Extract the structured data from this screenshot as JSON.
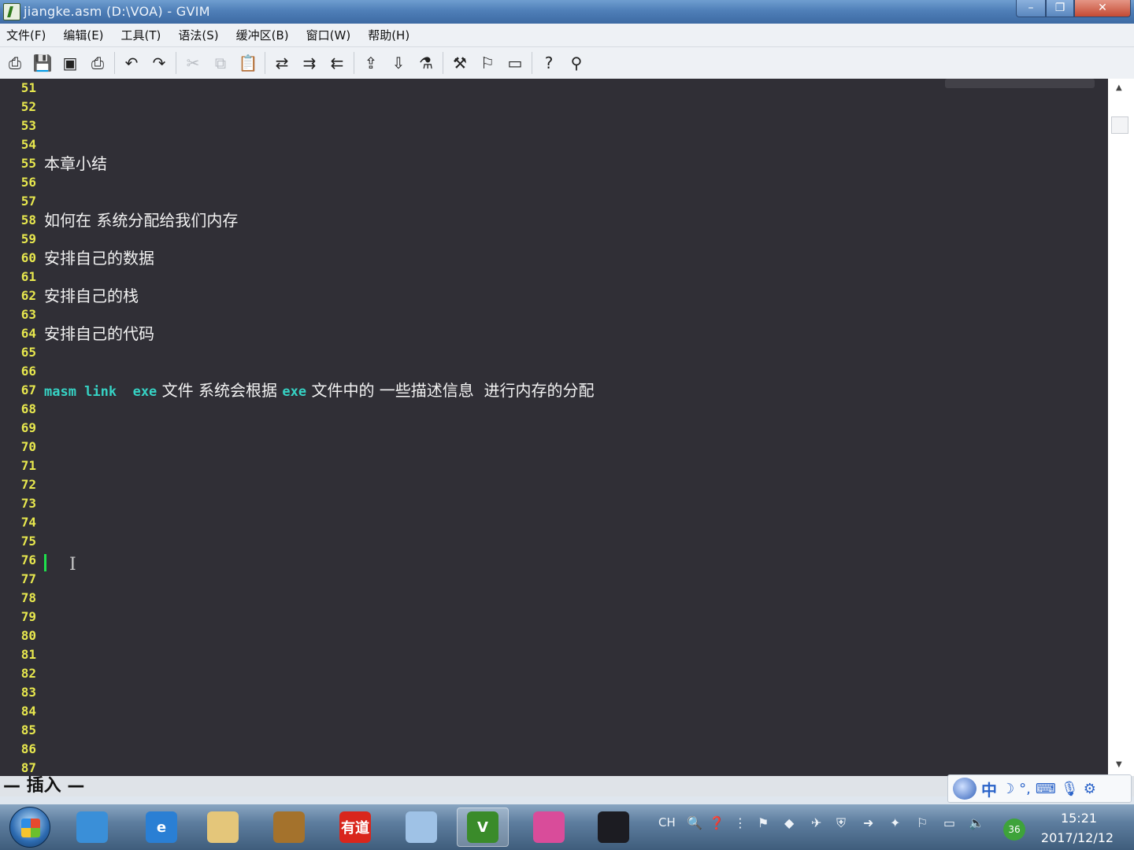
{
  "window": {
    "title": "jiangke.asm (D:\\VOA) - GVIM",
    "controls": {
      "minimize": "–",
      "maximize": "❐",
      "close": "✕"
    }
  },
  "menubar": {
    "items": [
      "文件(F)",
      "编辑(E)",
      "工具(T)",
      "语法(S)",
      "缓冲区(B)",
      "窗口(W)",
      "帮助(H)"
    ]
  },
  "toolbar": {
    "icons": [
      {
        "name": "open-icon",
        "glyph": "⎙"
      },
      {
        "name": "save-icon",
        "glyph": "💾"
      },
      {
        "name": "save-all-icon",
        "glyph": "▣"
      },
      {
        "name": "print-icon",
        "glyph": "⎙"
      },
      {
        "sep": true
      },
      {
        "name": "undo-icon",
        "glyph": "↶"
      },
      {
        "name": "redo-icon",
        "glyph": "↷"
      },
      {
        "sep": true
      },
      {
        "name": "cut-icon",
        "glyph": "✂",
        "dim": true
      },
      {
        "name": "copy-icon",
        "glyph": "⧉",
        "dim": true
      },
      {
        "name": "paste-icon",
        "glyph": "📋"
      },
      {
        "sep": true
      },
      {
        "name": "replace-icon",
        "glyph": "⇄"
      },
      {
        "name": "find-next-icon",
        "glyph": "⇉"
      },
      {
        "name": "find-prev-icon",
        "glyph": "⇇"
      },
      {
        "sep": true
      },
      {
        "name": "load-session-icon",
        "glyph": "⇪"
      },
      {
        "name": "save-session-icon",
        "glyph": "⇩"
      },
      {
        "name": "run-script-icon",
        "glyph": "⚗"
      },
      {
        "sep": true
      },
      {
        "name": "make-icon",
        "glyph": "⚒"
      },
      {
        "name": "shell-icon",
        "glyph": "⚐"
      },
      {
        "name": "tags-icon",
        "glyph": "▭"
      },
      {
        "sep": true
      },
      {
        "name": "help-icon",
        "glyph": "?"
      },
      {
        "name": "find-help-icon",
        "glyph": "⚲"
      }
    ]
  },
  "editor": {
    "lines": [
      {
        "n": "51",
        "text": ""
      },
      {
        "n": "52",
        "text": ""
      },
      {
        "n": "53",
        "text": ""
      },
      {
        "n": "54",
        "text": ""
      },
      {
        "n": "55",
        "text": "本章小结"
      },
      {
        "n": "56",
        "text": ""
      },
      {
        "n": "57",
        "text": ""
      },
      {
        "n": "58",
        "text": "如何在 系统分配给我们内存"
      },
      {
        "n": "59",
        "text": ""
      },
      {
        "n": "60",
        "text": "安排自己的数据"
      },
      {
        "n": "61",
        "text": ""
      },
      {
        "n": "62",
        "text": "安排自己的栈"
      },
      {
        "n": "63",
        "text": ""
      },
      {
        "n": "64",
        "text": "安排自己的代码"
      },
      {
        "n": "65",
        "text": ""
      },
      {
        "n": "66",
        "text": ""
      },
      {
        "n": "67",
        "segments": [
          {
            "kw": true,
            "t": "masm link  exe"
          },
          {
            "kw": false,
            "t": " 文件 系统会根据 "
          },
          {
            "kw": true,
            "t": "exe"
          },
          {
            "kw": false,
            "t": " 文件中的 一些描述信息  进行内存的分配"
          }
        ]
      },
      {
        "n": "68",
        "text": ""
      },
      {
        "n": "69",
        "text": ""
      },
      {
        "n": "70",
        "text": ""
      },
      {
        "n": "71",
        "text": ""
      },
      {
        "n": "72",
        "text": ""
      },
      {
        "n": "73",
        "text": ""
      },
      {
        "n": "74",
        "text": ""
      },
      {
        "n": "75",
        "text": ""
      },
      {
        "n": "76",
        "text": ""
      },
      {
        "n": "77",
        "text": ""
      },
      {
        "n": "78",
        "text": ""
      },
      {
        "n": "79",
        "text": ""
      },
      {
        "n": "80",
        "text": ""
      },
      {
        "n": "81",
        "text": ""
      },
      {
        "n": "82",
        "text": ""
      },
      {
        "n": "83",
        "text": ""
      },
      {
        "n": "84",
        "text": ""
      },
      {
        "n": "85",
        "text": ""
      },
      {
        "n": "86",
        "text": ""
      },
      {
        "n": "87",
        "text": ""
      }
    ],
    "cursor_line": "72",
    "colors": {
      "background": "#302f36",
      "line_number": "#e8e84e",
      "text": "#f2f2f2",
      "keyword": "#36d2c4",
      "cursor": "#1ee04c"
    }
  },
  "statusline": {
    "mode": "— 插入 —"
  },
  "ime": {
    "label": "中",
    "icons": [
      "moon-icon",
      "punctuation-icon",
      "keyboard-icon",
      "microphone-icon",
      "settings-icon"
    ]
  },
  "taskbar": {
    "apps": [
      {
        "name": "taskbar-app-store",
        "label": "",
        "color": "#3a8fd8"
      },
      {
        "name": "taskbar-ie",
        "label": "e",
        "color": "#2a7fd4"
      },
      {
        "name": "taskbar-explorer",
        "label": "",
        "color": "#e4c67a"
      },
      {
        "name": "taskbar-book-app",
        "label": "",
        "color": "#a4722c"
      },
      {
        "name": "taskbar-youdao",
        "label": "有道",
        "color": "#d9261c"
      },
      {
        "name": "taskbar-notepad",
        "label": "",
        "color": "#9fc2e6"
      },
      {
        "name": "taskbar-gvim",
        "label": "V",
        "color": "#3a8b2a",
        "active": true
      },
      {
        "name": "taskbar-color-app",
        "label": "",
        "color": "#d94c9a"
      },
      {
        "name": "taskbar-obs",
        "label": "",
        "color": "#1c1c22"
      }
    ],
    "tray": {
      "lang": "CH",
      "badge": "36"
    },
    "clock": {
      "time": "15:21",
      "date": "2017/12/12"
    }
  }
}
